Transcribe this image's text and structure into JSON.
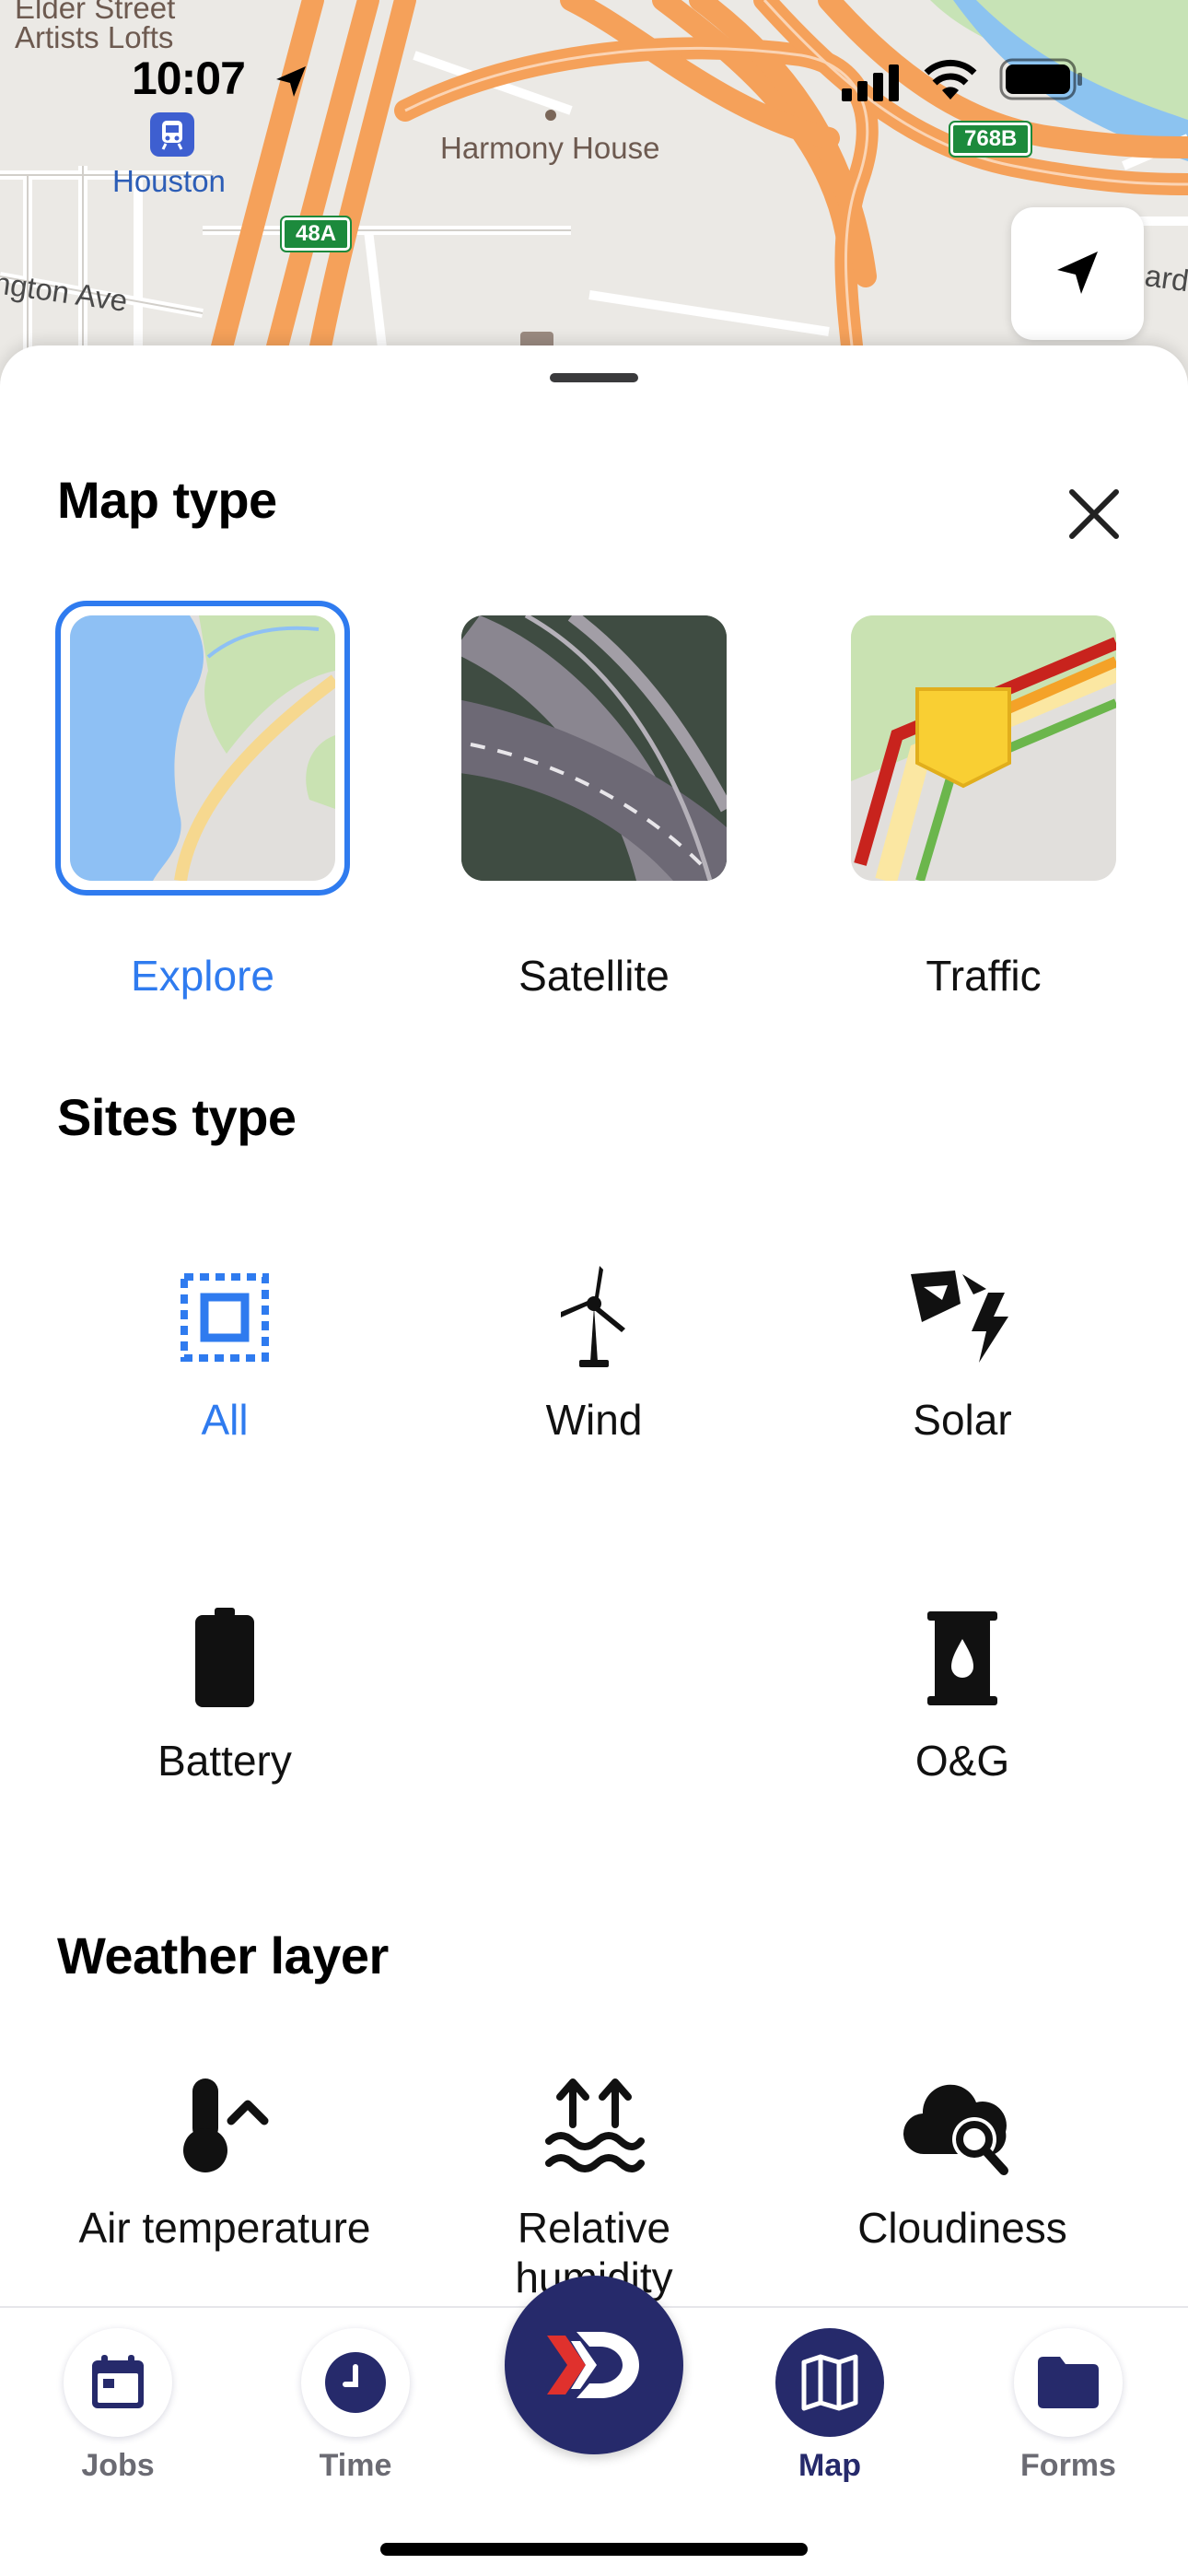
{
  "status_bar": {
    "time": "10:07"
  },
  "map": {
    "labels": {
      "elder_street": "Elder Street",
      "artists_lofts": "Artists Lofts",
      "houston": "Houston",
      "harmony_house": "Harmony House",
      "ave": "ngton Ave",
      "ard": "ard"
    },
    "shields": {
      "s48a": "48A",
      "s768b": "768B"
    }
  },
  "sheet": {
    "map_type": {
      "title": "Map type",
      "options": [
        {
          "label": "Explore",
          "selected": true
        },
        {
          "label": "Satellite",
          "selected": false
        },
        {
          "label": "Traffic",
          "selected": false
        }
      ]
    },
    "sites_type": {
      "title": "Sites type",
      "options": [
        {
          "label": "All",
          "icon": "all-sites-icon",
          "selected": true
        },
        {
          "label": "Wind",
          "icon": "wind-turbine-icon"
        },
        {
          "label": "Solar",
          "icon": "solar-icon"
        },
        {
          "label": "Battery",
          "icon": "battery-icon"
        },
        {
          "label": "O&G",
          "icon": "oil-barrel-icon"
        }
      ]
    },
    "weather_layer": {
      "title": "Weather layer",
      "options": [
        {
          "label": "Air temperature",
          "icon": "thermometer-icon"
        },
        {
          "label": "Relative humidity",
          "icon": "humidity-icon"
        },
        {
          "label": "Cloudiness",
          "icon": "cloud-search-icon"
        }
      ]
    }
  },
  "tab_bar": {
    "tabs": [
      {
        "label": "Jobs",
        "icon": "calendar-icon"
      },
      {
        "label": "Time",
        "icon": "clock-icon"
      },
      {
        "label": "Map",
        "icon": "map-icon",
        "active": true
      },
      {
        "label": "Forms",
        "icon": "folder-icon"
      }
    ]
  },
  "colors": {
    "accent": "#2f7bef",
    "brand_navy": "#262a6b",
    "brand_red": "#e0312d",
    "highway": "#f7a25b"
  }
}
